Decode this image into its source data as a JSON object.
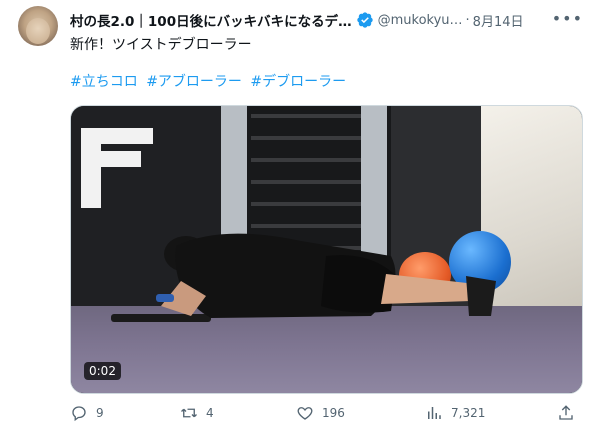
{
  "post": {
    "author_name": "村の長2.0｜100日後にバッキバキになるデ…",
    "handle": "@mukokyu…",
    "separator": "·",
    "date": "8月14日",
    "more_icon": "more-icon",
    "text": "新作！ツイストデブローラー",
    "hashtags": [
      "#立ちコロ",
      "#アブローラー",
      "#デブローラー"
    ]
  },
  "media": {
    "timecode": "0:02"
  },
  "actions": {
    "replies": "9",
    "reposts": "4",
    "likes": "196",
    "views": "7,321"
  },
  "colors": {
    "accent": "#1d9bf0",
    "muted": "#536471",
    "text": "#0f1419"
  }
}
